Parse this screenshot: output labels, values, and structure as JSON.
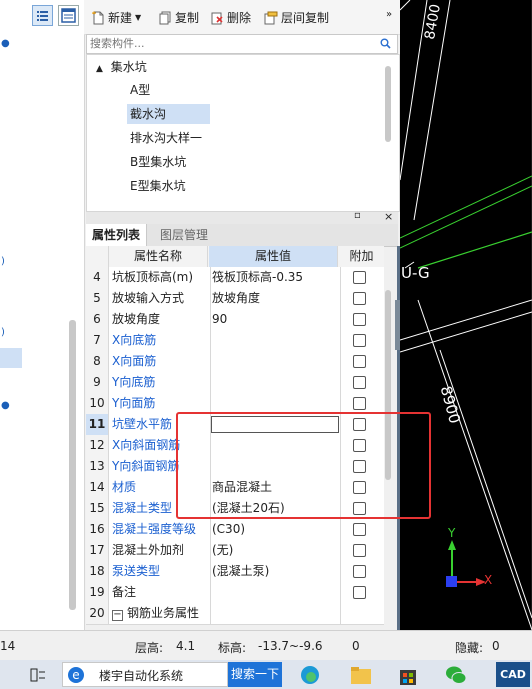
{
  "toolbar": {
    "new_label": "新建",
    "copy_label": "复制",
    "delete_label": "删除",
    "floor_copy_label": "层间复制"
  },
  "search": {
    "placeholder": "搜索构件..."
  },
  "tree": {
    "root": "集水坑",
    "items": [
      "A型",
      "截水沟",
      "排水沟大样一",
      "B型集水坑",
      "E型集水坑"
    ],
    "selected_index": 1
  },
  "tabs": {
    "properties": "属性列表",
    "layers": "图层管理"
  },
  "grid": {
    "headers": {
      "name": "属性名称",
      "value": "属性值",
      "add": "附加"
    },
    "rows": [
      {
        "n": "4",
        "name": "坑板顶标高(m)",
        "value": "筏板顶标高-0.35"
      },
      {
        "n": "5",
        "name": "放坡输入方式",
        "value": "放坡角度"
      },
      {
        "n": "6",
        "name": "放坡角度",
        "value": "90"
      },
      {
        "n": "7",
        "name": "X向底筋",
        "value": ""
      },
      {
        "n": "8",
        "name": "X向面筋",
        "value": ""
      },
      {
        "n": "9",
        "name": "Y向底筋",
        "value": ""
      },
      {
        "n": "10",
        "name": "Y向面筋",
        "value": ""
      },
      {
        "n": "11",
        "name": "坑壁水平筋",
        "value": ""
      },
      {
        "n": "12",
        "name": "X向斜面钢筋",
        "value": ""
      },
      {
        "n": "13",
        "name": "Y向斜面钢筋",
        "value": ""
      },
      {
        "n": "14",
        "name": "材质",
        "value": "商品混凝土"
      },
      {
        "n": "15",
        "name": "混凝土类型",
        "value": "(混凝土20石)"
      },
      {
        "n": "16",
        "name": "混凝土强度等级",
        "value": "(C30)"
      },
      {
        "n": "17",
        "name": "混凝土外加剂",
        "value": "(无)"
      },
      {
        "n": "18",
        "name": "泵送类型",
        "value": "(混凝土泵)"
      },
      {
        "n": "19",
        "name": "备注",
        "value": ""
      },
      {
        "n": "20",
        "name": "钢筋业务属性",
        "value": ""
      }
    ]
  },
  "cad": {
    "dim_top": "8400",
    "axis_label": "U-G",
    "dim_mid": "8900",
    "axis_x": "X",
    "axis_y": "Y"
  },
  "statusbar": {
    "left_value": "14",
    "floor_height_label": "层高:",
    "floor_height_value": "4.1",
    "elevation_label": "标高:",
    "elevation_value": "-13.7~-9.6",
    "count_value": "0",
    "hidden_label": "隐藏:",
    "hidden_value": "0"
  },
  "taskbar": {
    "app_label": "楼宇自动化系统",
    "search_label": "搜索一下",
    "cad_label": "CAD"
  },
  "colors": {
    "blue_link": "#1a5fd0",
    "red_highlight": "#e53333",
    "cad_green": "#39d030"
  }
}
